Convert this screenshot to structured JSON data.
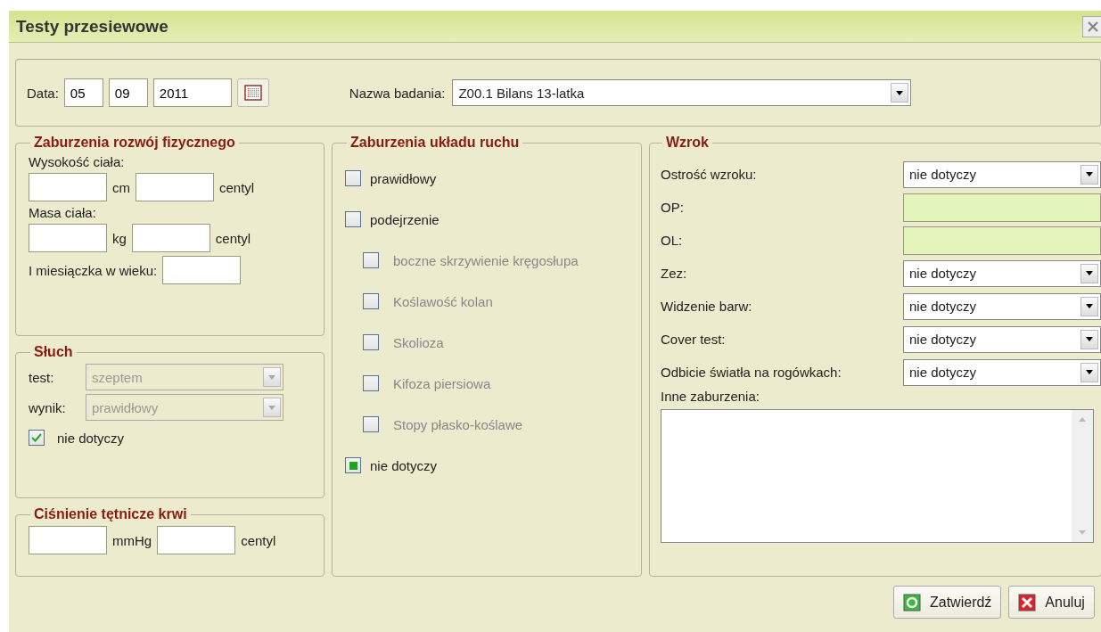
{
  "window": {
    "title": "Testy przesiewowe"
  },
  "header": {
    "date_label": "Data:",
    "day": "05",
    "month": "09",
    "year": "2011",
    "exam_label": "Nazwa badania:",
    "exam": "Z00.1 Bilans 13-latka"
  },
  "physical": {
    "title": "Zaburzenia rozwój fizycznego",
    "height_label": "Wysokość ciała:",
    "height_unit": "cm",
    "height_centile": "centyl",
    "mass_label": "Masa ciała:",
    "mass_unit": "kg",
    "mass_centile": "centyl",
    "menarche_label": "I miesiączka w wieku:"
  },
  "hearing": {
    "title": "Słuch",
    "fields": [
      {
        "label": "test:",
        "value": "szeptem",
        "disabled": true
      },
      {
        "label": "wynik:",
        "value": "prawidłowy",
        "disabled": true
      }
    ],
    "na": {
      "label": "nie dotyczy",
      "checked": true
    }
  },
  "pressure": {
    "title": "Ciśnienie tętnicze krwi",
    "unit": "mmHg",
    "centile": "centyl"
  },
  "movement": {
    "title": "Zaburzenia układu ruchu",
    "items": [
      {
        "label": "prawidłowy",
        "checked": false,
        "disabled": false
      },
      {
        "label": "podejrzenie",
        "checked": false,
        "disabled": false,
        "children": [
          {
            "label": "boczne skrzywienie kręgosłupa",
            "checked": false,
            "disabled": true
          },
          {
            "label": "Koślawość kolan",
            "checked": false,
            "disabled": true
          },
          {
            "label": "Skolioza",
            "checked": false,
            "disabled": true
          },
          {
            "label": "Kifoza piersiowa",
            "checked": false,
            "disabled": true
          },
          {
            "label": "Stopy płasko-koślawe",
            "checked": false,
            "disabled": true
          }
        ]
      },
      {
        "label": "nie dotyczy",
        "checked": true,
        "disabled": false
      }
    ]
  },
  "vision": {
    "title": "Wzrok",
    "rows": [
      {
        "label": "Ostrość wzroku:",
        "kind": "select",
        "value": "nie dotyczy"
      },
      {
        "label": "OP:",
        "kind": "text"
      },
      {
        "label": "OL:",
        "kind": "text"
      },
      {
        "label": "Zez:",
        "kind": "select",
        "value": "nie dotyczy"
      },
      {
        "label": "Widzenie barw:",
        "kind": "select",
        "value": "nie dotyczy"
      },
      {
        "label": "Cover test:",
        "kind": "select",
        "value": "nie dotyczy"
      },
      {
        "label": "Odbicie światła na rogówkach:",
        "kind": "select",
        "value": "nie dotyczy"
      }
    ],
    "other_label": "Inne zaburzenia:"
  },
  "buttons": [
    {
      "label": "Zatwierdź",
      "kind": "confirm"
    },
    {
      "label": "Anuluj",
      "kind": "cancel"
    }
  ]
}
